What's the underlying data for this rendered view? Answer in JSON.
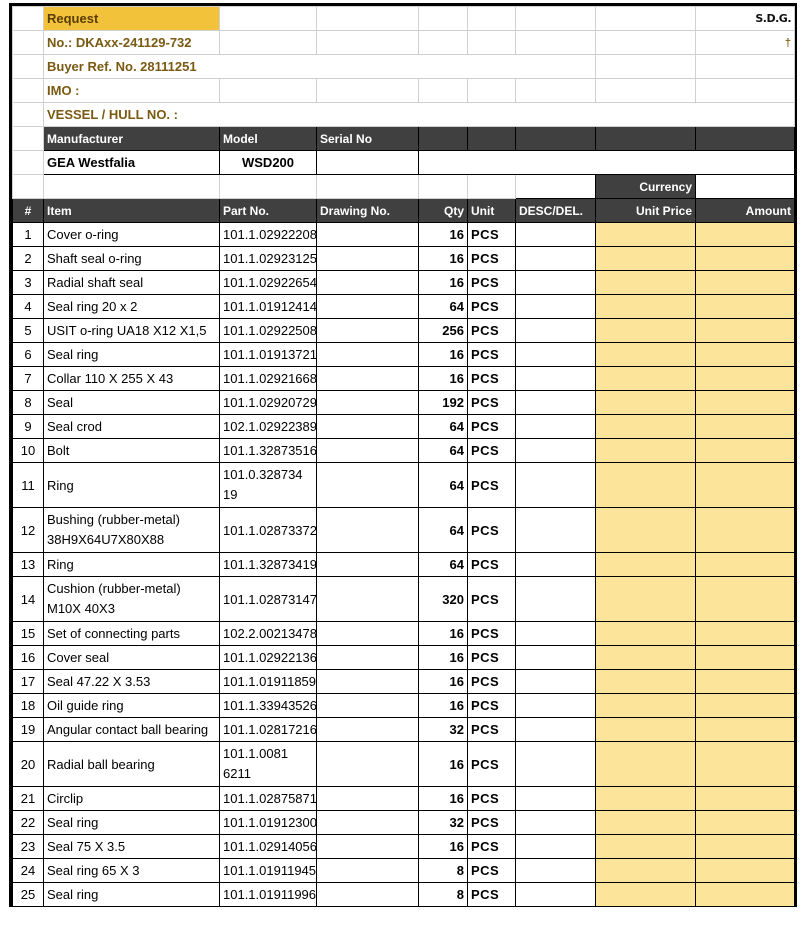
{
  "header": {
    "request_label": "Request",
    "request_no": "No.:  DKAxx-241129-732",
    "buyer_ref": "Buyer Ref. No. 28111251",
    "imo": "IMO :",
    "vessel": "VESSEL / HULL NO. :",
    "sdg": "S.D.G.",
    "cross_symbol": "†"
  },
  "equipment": {
    "columns": [
      "Manufacturer",
      "Model",
      "Serial No"
    ],
    "manufacturer": "GEA Westfalia",
    "model": "WSD200",
    "serial_no": ""
  },
  "currency_label": "Currency",
  "currency_value": "",
  "columns": {
    "num": "#",
    "item": "Item",
    "part_no": "Part No.",
    "drawing_no": "Drawing No.",
    "qty": "Qty",
    "unit": "Unit",
    "desc_del": "DESC/DEL.",
    "unit_price": "Unit Price",
    "amount": "Amount"
  },
  "rows": [
    {
      "n": "1",
      "item": "Cover o-ring",
      "part": "101.1.02922208",
      "qty": "16",
      "unit": "PCS"
    },
    {
      "n": "2",
      "item": "Shaft seal o-ring",
      "part": "101.1.02923125",
      "qty": "16",
      "unit": "PCS"
    },
    {
      "n": "3",
      "item": "Radial shaft seal",
      "part": "101.1.02922654",
      "qty": "16",
      "unit": "PCS"
    },
    {
      "n": "4",
      "item": "Seal ring 20 x 2",
      "part": "101.1.01912414",
      "qty": "64",
      "unit": "PCS"
    },
    {
      "n": "5",
      "item": "USIT o-ring UA18 X12 X1,5",
      "part": "101.1.02922508",
      "qty": "256",
      "unit": "PCS"
    },
    {
      "n": "6",
      "item": "Seal ring",
      "part": "101.1.01913721",
      "qty": "16",
      "unit": "PCS"
    },
    {
      "n": "7",
      "item": "Collar 110 X 255 X 43",
      "part": "101.1.02921668",
      "qty": "16",
      "unit": "PCS"
    },
    {
      "n": "8",
      "item": "Seal",
      "part": "101.1.02920729",
      "qty": "192",
      "unit": "PCS"
    },
    {
      "n": "9",
      "item": "Seal crod",
      "part": "102.1.02922389",
      "qty": "64",
      "unit": "PCS"
    },
    {
      "n": "10",
      "item": "Bolt",
      "part": "101.1.32873516",
      "qty": "64",
      "unit": "PCS"
    },
    {
      "n": "11",
      "item": "Ring",
      "part": "101.0.328734\n19",
      "qty": "64",
      "unit": "PCS",
      "tall": true
    },
    {
      "n": "12",
      "item": "Bushing (rubber-metal)\n38H9X64U7X80X88",
      "part": "101.1.02873372",
      "qty": "64",
      "unit": "PCS",
      "tall": true
    },
    {
      "n": "13",
      "item": "Ring",
      "part": "101.1.32873419",
      "qty": "64",
      "unit": "PCS"
    },
    {
      "n": "14",
      "item": "Cushion (rubber-metal)\nM10X 40X3",
      "part": "101.1.02873147",
      "qty": "320",
      "unit": "PCS",
      "tall": true
    },
    {
      "n": "15",
      "item": "Set of connecting parts",
      "part": "102.2.00213478",
      "qty": "16",
      "unit": "PCS"
    },
    {
      "n": "16",
      "item": "Cover seal",
      "part": "101.1.02922136",
      "qty": "16",
      "unit": "PCS"
    },
    {
      "n": "17",
      "item": "Seal 47.22 X 3.53",
      "part": "101.1.01911859",
      "qty": "16",
      "unit": "PCS"
    },
    {
      "n": "18",
      "item": "Oil guide ring",
      "part": "101.1.33943526",
      "qty": "16",
      "unit": "PCS"
    },
    {
      "n": "19",
      "item": "Angular contact ball bearing",
      "part": "101.1.02817216",
      "qty": "32",
      "unit": "PCS"
    },
    {
      "n": "20",
      "item": "Radial ball bearing",
      "part": "101.1.0081\n6211",
      "qty": "16",
      "unit": "PCS",
      "tall": true
    },
    {
      "n": "21",
      "item": "Circlip",
      "part": "101.1.02875871",
      "qty": "16",
      "unit": "PCS"
    },
    {
      "n": "22",
      "item": "Seal ring",
      "part": "101.1.01912300",
      "qty": "32",
      "unit": "PCS"
    },
    {
      "n": "23",
      "item": "Seal 75 X 3.5",
      "part": "101.1.02914056",
      "qty": "16",
      "unit": "PCS"
    },
    {
      "n": "24",
      "item": "Seal ring 65 X 3",
      "part": "101.1.01911945",
      "qty": "8",
      "unit": "PCS"
    },
    {
      "n": "25",
      "item": "Seal ring",
      "part": "101.1.01911996",
      "qty": "8",
      "unit": "PCS"
    }
  ],
  "colors": {
    "request_fill": "#f2c23a",
    "header_text": "#7a5a12",
    "dark_header": "#404040",
    "price_fill": "#fde49b"
  }
}
